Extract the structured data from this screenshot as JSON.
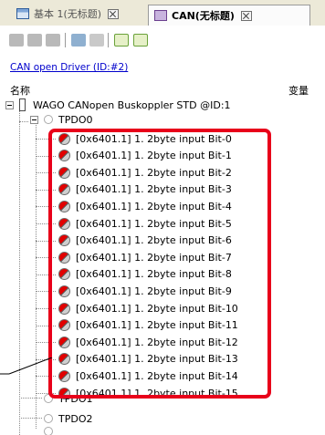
{
  "tabs": [
    {
      "label": "基本 1(无标题)",
      "active": false
    },
    {
      "label": "CAN(无标题)",
      "active": true
    }
  ],
  "toolbar": {
    "buttons": [
      "import-icon",
      "cut-icon",
      "paste-icon",
      "add-icon",
      "delete-icon",
      "expand-all-icon",
      "collapse-all-icon"
    ],
    "small_labels": [
      "ALL",
      "ALL"
    ]
  },
  "driver_link": "CAN open Driver (ID:#2)",
  "columns": {
    "name": "名称",
    "variable": "变量"
  },
  "tree": {
    "device": "WAGO CANopen Buskoppler STD @ID:1",
    "pdo_open": "TPDO0",
    "items": [
      "[0x6401.1] 1. 2byte input Bit-0",
      "[0x6401.1] 1. 2byte input Bit-1",
      "[0x6401.1] 1. 2byte input Bit-2",
      "[0x6401.1] 1. 2byte input Bit-3",
      "[0x6401.1] 1. 2byte input Bit-4",
      "[0x6401.1] 1. 2byte input Bit-5",
      "[0x6401.1] 1. 2byte input Bit-6",
      "[0x6401.1] 1. 2byte input Bit-7",
      "[0x6401.1] 1. 2byte input Bit-8",
      "[0x6401.1] 1. 2byte input Bit-9",
      "[0x6401.1] 1. 2byte input Bit-10",
      "[0x6401.1] 1. 2byte input Bit-11",
      "[0x6401.1] 1. 2byte input Bit-12",
      "[0x6401.1] 1. 2byte input Bit-13",
      "[0x6401.1] 1. 2byte input Bit-14",
      "[0x6401.1] 1. 2byte input Bit-15"
    ],
    "pdo_after": [
      "TPDO1",
      "TPDO2"
    ]
  },
  "colors": {
    "highlight": "#e8001a",
    "link": "#0000cc",
    "tab_bar": "#ece9d8"
  }
}
